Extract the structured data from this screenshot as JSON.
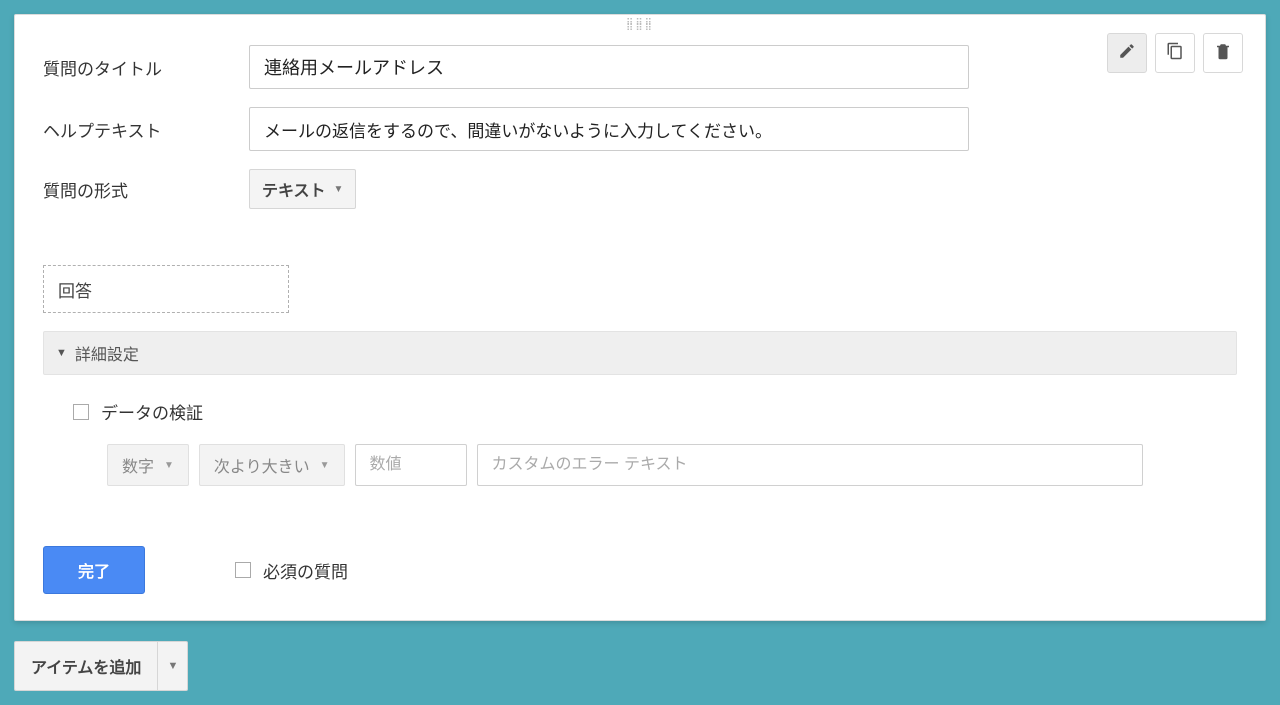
{
  "question": {
    "title_label": "質問のタイトル",
    "title_value": "連絡用メールアドレス",
    "help_label": "ヘルプテキスト",
    "help_value": "メールの返信をするので、間違いがないように入力してください。",
    "type_label": "質問の形式",
    "type_value": "テキスト"
  },
  "answer": {
    "placeholder_text": "回答"
  },
  "advanced": {
    "header": "詳細設定",
    "validation_label": "データの検証",
    "validation_type": "数字",
    "validation_cond": "次より大きい",
    "value_placeholder": "数値",
    "error_placeholder": "カスタムのエラー テキスト"
  },
  "footer": {
    "done": "完了",
    "required_label": "必須の質問"
  },
  "add_item": {
    "label": "アイテムを追加"
  }
}
